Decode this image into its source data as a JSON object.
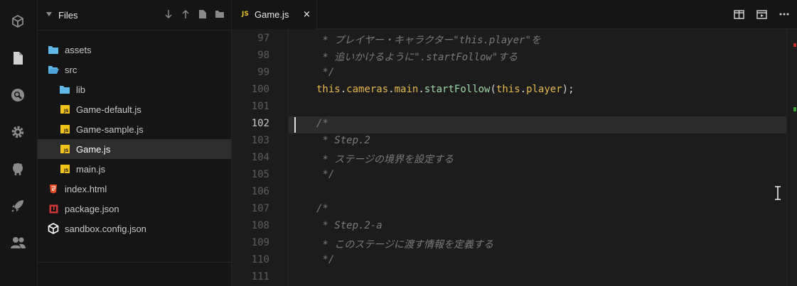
{
  "activity_bar": {
    "items": [
      {
        "name": "project-icon"
      },
      {
        "name": "files-icon"
      },
      {
        "name": "search-icon"
      },
      {
        "name": "settings-icon"
      },
      {
        "name": "github-icon"
      },
      {
        "name": "deploy-icon"
      },
      {
        "name": "live-icon"
      }
    ]
  },
  "explorer": {
    "title": "Files",
    "tree": [
      {
        "label": "assets",
        "icon": "folder-icon"
      },
      {
        "label": "src",
        "icon": "folder-open-icon"
      },
      {
        "label": "lib",
        "icon": "folder-icon"
      },
      {
        "label": "Game-default.js",
        "icon": "js-icon"
      },
      {
        "label": "Game-sample.js",
        "icon": "js-icon"
      },
      {
        "label": "Game.js",
        "icon": "js-icon",
        "active": true
      },
      {
        "label": "main.js",
        "icon": "js-icon"
      },
      {
        "label": "index.html",
        "icon": "html5-icon"
      },
      {
        "label": "package.json",
        "icon": "npm-icon"
      },
      {
        "label": "sandbox.config.json",
        "icon": "codesandbox-icon"
      }
    ]
  },
  "tab": {
    "badge": "JS",
    "title": "Game.js",
    "close": "×"
  },
  "editor": {
    "current_line": "102",
    "lines": [
      {
        "n": "97",
        "text": " * プレイヤー・キャラクター\"this.player\"を"
      },
      {
        "n": "98",
        "text": " * 追いかけるように\".startFollow\"する"
      },
      {
        "n": "99",
        "text": " */"
      },
      {
        "n": "100",
        "t1": "this",
        "t2": ".",
        "t3": "cameras",
        "t4": ".",
        "t5": "main",
        "t6": ".",
        "t7": "startFollow",
        "t8": "(",
        "t9": "this",
        "t10": ".",
        "t11": "player",
        "t12": ");"
      },
      {
        "n": "101",
        "text": ""
      },
      {
        "n": "102",
        "text": "/*"
      },
      {
        "n": "103",
        "text": " * Step.2"
      },
      {
        "n": "104",
        "text": " * ステージの境界を設定する"
      },
      {
        "n": "105",
        "text": " */"
      },
      {
        "n": "106",
        "text": ""
      },
      {
        "n": "107",
        "text": "/*"
      },
      {
        "n": "108",
        "text": " * Step.2-a"
      },
      {
        "n": "109",
        "text": " * このステージに渡す情報を定義する"
      },
      {
        "n": "110",
        "text": " */"
      },
      {
        "n": "111",
        "text": ""
      }
    ]
  },
  "colors": {
    "accent": "#e6c229",
    "keyword": "#e6b84a",
    "function": "#9fd7a8",
    "comment": "#7a7a7a"
  }
}
